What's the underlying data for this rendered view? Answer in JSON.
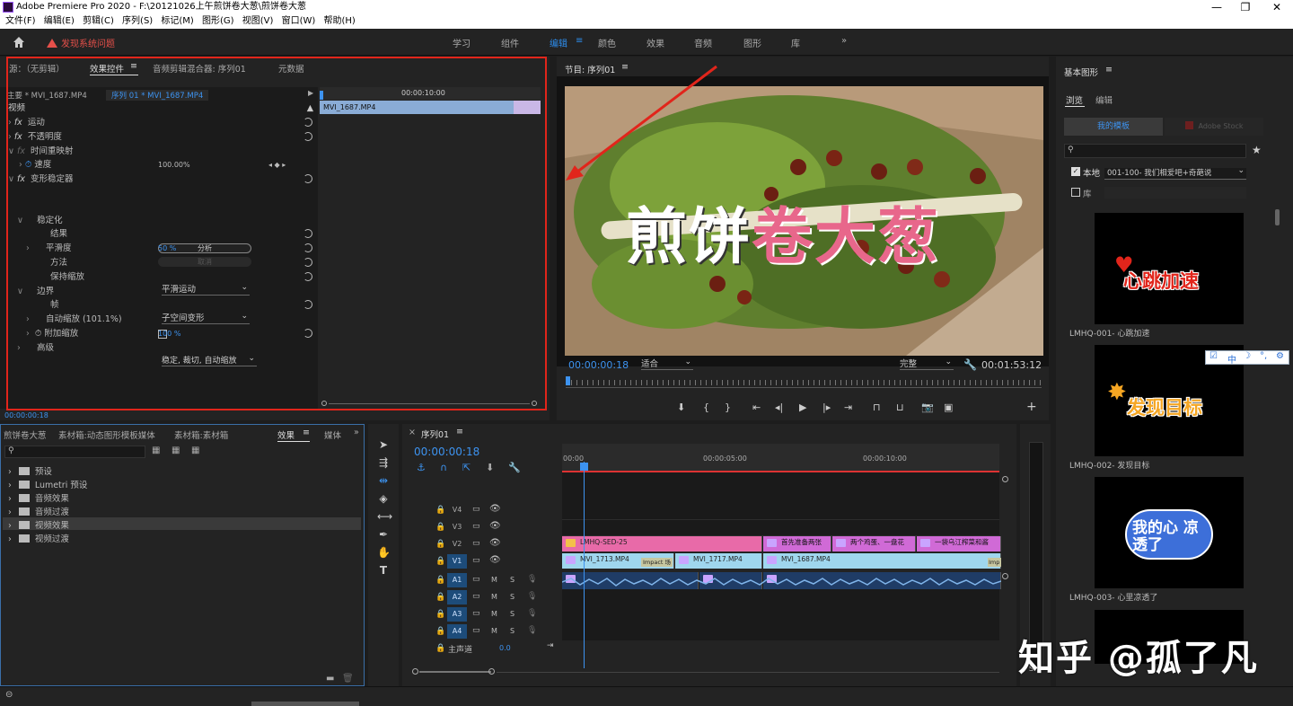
{
  "window": {
    "title": "Adobe Premiere Pro 2020 - F:\\20121026上午煎饼卷大葱\\煎饼卷大葱",
    "controls": [
      "—",
      "❐",
      "✕"
    ]
  },
  "menu": [
    "文件(F)",
    "编辑(E)",
    "剪辑(C)",
    "序列(S)",
    "标记(M)",
    "图形(G)",
    "视图(V)",
    "窗口(W)",
    "帮助(H)"
  ],
  "warning": "发现系统问题",
  "workspaces": [
    "学习",
    "组件",
    "编辑",
    "颜色",
    "效果",
    "音频",
    "图形",
    "库"
  ],
  "workspace_active": "编辑",
  "effect_controls": {
    "tabs": [
      "源：（无剪辑）",
      "效果控件",
      "音频剪辑混合器: 序列01",
      "元数据"
    ],
    "master": "主要 * MVI_1687.MP4",
    "sequence": "序列 01 * MVI_1687.MP4",
    "timecode_ruler": "00:00:10:00",
    "clip_name": "MVI_1687.MP4",
    "section_video": "视频",
    "rows": {
      "motion": "运动",
      "opacity": "不透明度",
      "time_remap": "时间重映射",
      "speed": "速度",
      "speed_val": "100.00%",
      "stabilizer": "变形稳定器",
      "analyze_btn": "分析",
      "cancel_btn": "取消",
      "stabilization": "稳定化",
      "result": "结果",
      "result_val": "平滑运动",
      "smoothness": "平滑度",
      "smoothness_val": "50 %",
      "method": "方法",
      "method_val": "子空间变形",
      "keep_scale": "保持缩放",
      "border": "边界",
      "framing": "帧",
      "framing_val": "稳定, 裁切, 自动缩放",
      "auto_scale": "自动缩放 (101.1%)",
      "add_scale": "附加缩放",
      "add_scale_val": "100 %",
      "advanced": "高级"
    },
    "timecode": "00:00:00:18"
  },
  "program": {
    "title": "节目: 序列01",
    "overlay_white": "煎饼",
    "overlay_pink": "卷大葱",
    "timecode": "00:00:00:18",
    "fit": "适合",
    "quality": "完整",
    "duration": "00:01:53:12"
  },
  "project": {
    "tabs": [
      "煎饼卷大葱",
      "素材箱:动态图形模板媒体",
      "素材箱:素材箱",
      "效果",
      "媒体"
    ],
    "items": [
      "预设",
      "Lumetri 预设",
      "音频效果",
      "音频过渡",
      "视频效果",
      "视频过渡"
    ],
    "selected": "视频效果"
  },
  "timeline": {
    "title": "序列01",
    "timecode": "00:00:00:18",
    "ruler": [
      "00:00",
      "00:00:05:00",
      "00:00:10:00"
    ],
    "video_tracks": [
      "V4",
      "V3",
      "V2",
      "V1"
    ],
    "audio_tracks": [
      "A1",
      "A2",
      "A3",
      "A4"
    ],
    "master": "主声道",
    "master_val": "0.0",
    "v2_clips": [
      "LMHQ-SED-25",
      "首先准备两张",
      "两个鸡蛋、一盘花",
      "一袋乌江榨菜和酱"
    ],
    "v1_clips": [
      "MVI_1713.MP4",
      "MVI_1717.MP4",
      "MVI_1687.MP4"
    ],
    "impact": "Impact 场",
    "impact2": "Imp",
    "m": "M",
    "s": "S"
  },
  "graphics": {
    "title": "基本图形",
    "tabs": [
      "浏览",
      "编辑"
    ],
    "sources": [
      "我的模板",
      "Adobe Stock"
    ],
    "local_label": "本地",
    "local_select": "001-100- 我们相爱吧+奇葩说",
    "lib_label": "库",
    "templates": [
      {
        "art": "心跳加速",
        "label": "LMHQ-001- 心跳加速"
      },
      {
        "art": "发现目标",
        "label": "LMHQ-002- 发现目标"
      },
      {
        "art": "我的心 凉透了",
        "label": "LMHQ-003- 心里凉透了"
      }
    ],
    "ime": [
      "中"
    ]
  },
  "watermark": "知乎 @孤了凡"
}
